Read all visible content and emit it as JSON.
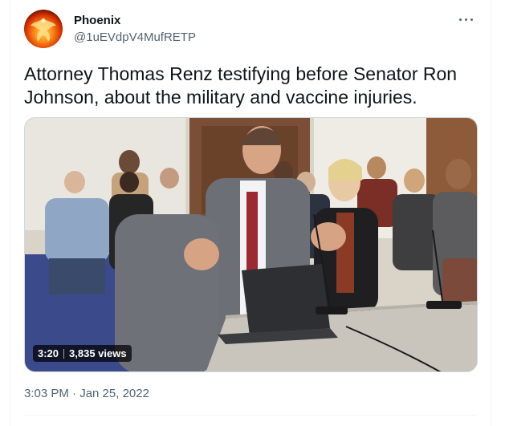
{
  "author": {
    "display_name": "Phoenix",
    "handle": "@1uEVdpV4MufRETP",
    "avatar_icon": "phoenix-bird-icon"
  },
  "tweet": {
    "text": "Attorney Thomas Renz testifying before Senator Ron Johnson, about the military and vaccine injuries."
  },
  "media": {
    "type": "video",
    "duration": "3:20",
    "views": "3,835 views"
  },
  "meta": {
    "timestamp": "3:03 PM · Jan 25, 2022"
  },
  "icons": {
    "more": "more-horizontal-icon"
  },
  "colors": {
    "text_primary": "#0f1419",
    "text_secondary": "#536471",
    "border": "#cfd9de"
  }
}
